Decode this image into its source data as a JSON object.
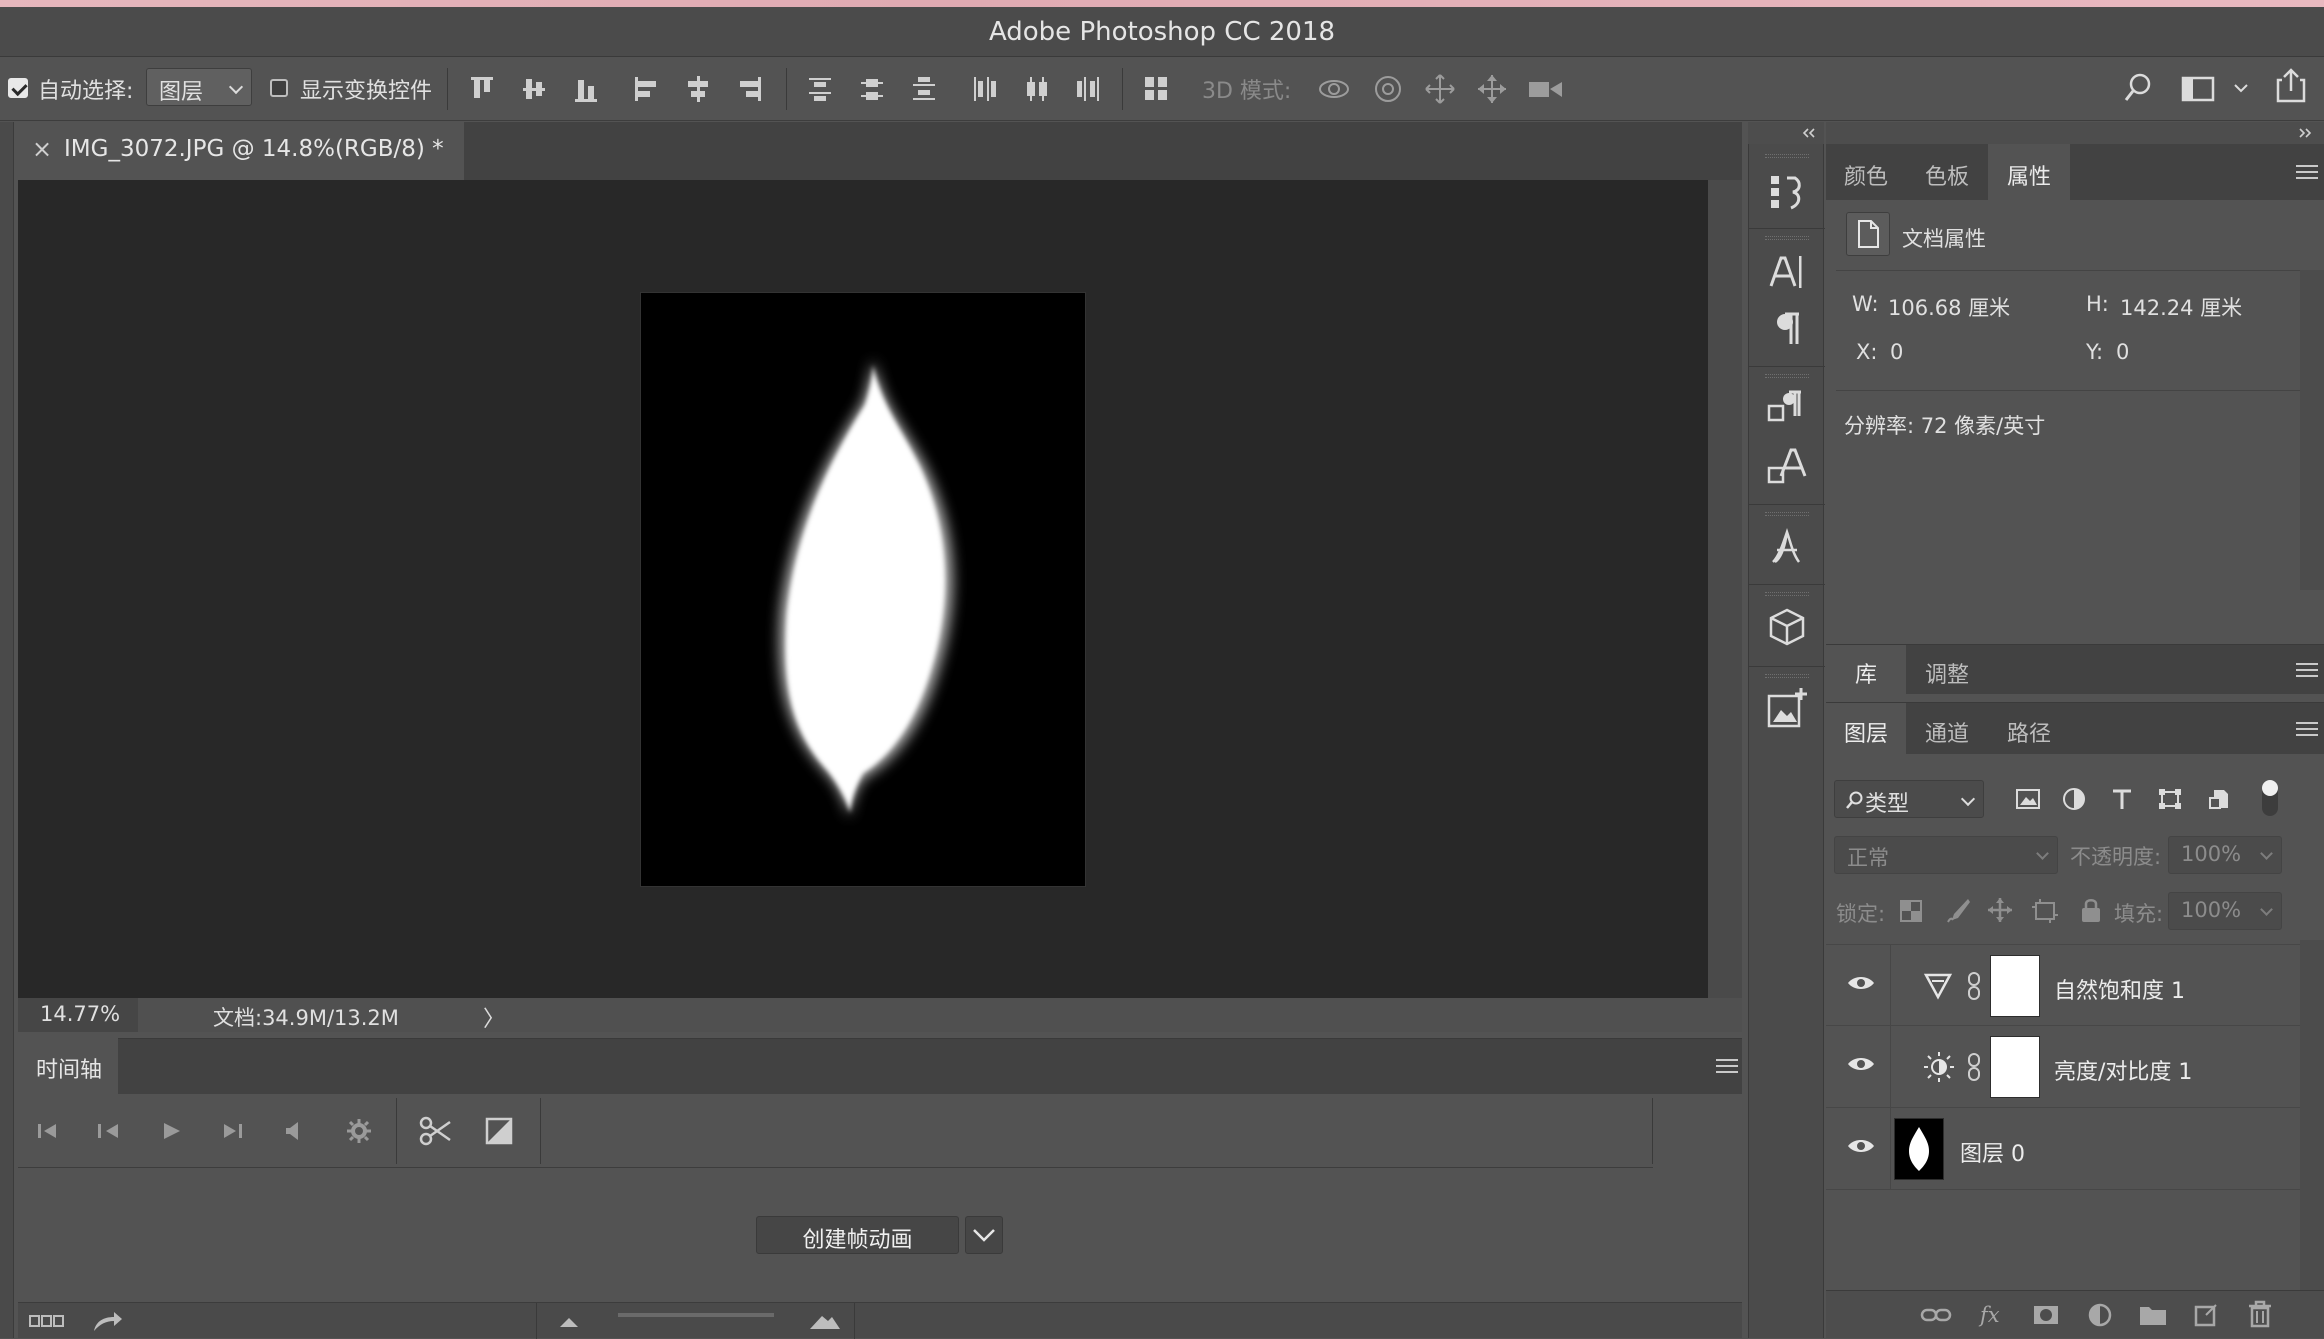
{
  "window": {
    "title": "Adobe Photoshop CC 2018"
  },
  "options_bar": {
    "auto_select_label": "自动选择:",
    "auto_select_checked": true,
    "auto_select_target": "图层",
    "show_transform_label": "显示变换控件",
    "show_transform_checked": false,
    "mode_3d_label": "3D 模式:"
  },
  "document": {
    "tab_title": "IMG_3072.JPG @ 14.8%(RGB/8) *",
    "zoom": "14.77%",
    "doc_size": "文档:34.9M/13.2M",
    "more_arrow": "〉"
  },
  "timeline": {
    "title": "时间轴",
    "create_button": "创建帧动画"
  },
  "properties_panel": {
    "tabs": [
      "颜色",
      "色板",
      "属性"
    ],
    "active_tab": "属性",
    "section_title": "文档属性",
    "w_label": "W:",
    "w_value": "106.68 厘米",
    "h_label": "H:",
    "h_value": "142.24 厘米",
    "x_label": "X:",
    "x_value": "0",
    "y_label": "Y:",
    "y_value": "0",
    "resolution": "分辨率: 72 像素/英寸"
  },
  "library_panel": {
    "tabs": [
      "库",
      "调整"
    ]
  },
  "layers_panel": {
    "tabs": [
      "图层",
      "通道",
      "路径"
    ],
    "filter_kind": "类型",
    "blend_mode": "正常",
    "opacity_label": "不透明度:",
    "opacity_value": "100%",
    "lock_label": "锁定:",
    "fill_label": "填充:",
    "fill_value": "100%",
    "layers": [
      {
        "name": "自然饱和度 1",
        "type": "vibrance",
        "visible": true
      },
      {
        "name": "亮度/对比度 1",
        "type": "brightness-contrast",
        "visible": true
      },
      {
        "name": "图层 0",
        "type": "pixel",
        "visible": true
      }
    ]
  },
  "colors": {
    "ui_background": "#535353",
    "canvas_background": "#282828",
    "panel_tab_bar": "#424242"
  }
}
